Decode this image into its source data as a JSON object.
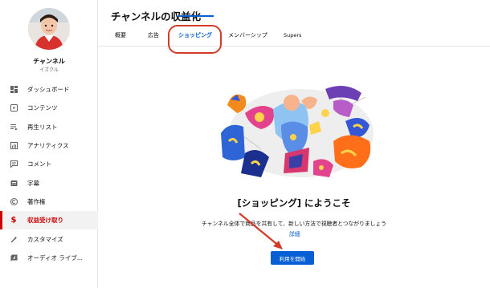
{
  "header": {
    "title": "チャンネルの収益化"
  },
  "channel": {
    "name": "チャンネル",
    "handle": "イズクル"
  },
  "sidebar": {
    "items": [
      {
        "label": "ダッシュボード",
        "icon": "dashboard-icon"
      },
      {
        "label": "コンテンツ",
        "icon": "content-icon"
      },
      {
        "label": "再生リスト",
        "icon": "playlist-icon"
      },
      {
        "label": "アナリティクス",
        "icon": "analytics-icon"
      },
      {
        "label": "コメント",
        "icon": "comment-icon"
      },
      {
        "label": "字幕",
        "icon": "subtitles-icon"
      },
      {
        "label": "著作権",
        "icon": "copyright-icon"
      },
      {
        "label": "収益受け取り",
        "icon": "dollar-icon",
        "active": true
      },
      {
        "label": "カスタマイズ",
        "icon": "magic-wand-icon"
      },
      {
        "label": "オーディオ ライブ...",
        "icon": "audio-library-icon"
      }
    ]
  },
  "tabs": [
    {
      "label": "概要"
    },
    {
      "label": "広告"
    },
    {
      "label": "ショッピング",
      "active": true
    },
    {
      "label": "メンバーシップ"
    },
    {
      "label": "Supers"
    }
  ],
  "welcome": {
    "title": "[ショッピング] にようこそ",
    "description": "チャンネル全体で商品を共有して、新しい方法で視聴者とつながりましょう",
    "details_link": "詳細",
    "start_button": "利用を開始"
  },
  "colors": {
    "accent": "#065fd4",
    "active_red": "#cc0000",
    "annotation_red": "#d23b2a"
  }
}
